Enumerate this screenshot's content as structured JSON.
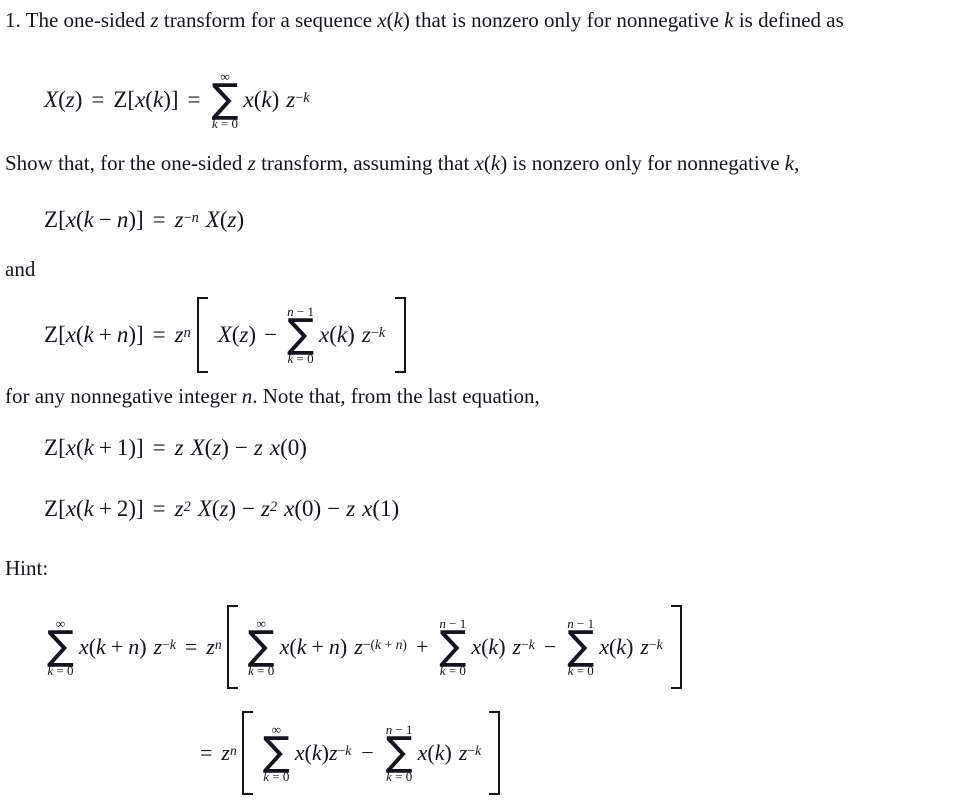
{
  "document": {
    "title": "One-sided z transform problem",
    "background_color": "#ffffff",
    "text_color": "#14141f"
  },
  "prose": {
    "problem_statement": "1. The one-sided z transform for a sequence x(k) that is nonzero only for nonnegative k is defined as",
    "p1_a": "1. The one-sided ",
    "p1_z": "z",
    "p1_b": " transform for a sequence ",
    "p1_x": "x",
    "p1_c": "(",
    "p1_k": "k",
    "p1_d": ") that is nonzero only for nonnegative ",
    "p1_k2": "k",
    "p1_e": " is defined as",
    "show_that_full": "Show that, for the one-sided z transform, assuming that x(k) is nonzero only for nonnegative k,",
    "p2_a": "Show that, for the one-sided ",
    "p2_z": "z",
    "p2_b": " transform, assuming that ",
    "p2_x": "x",
    "p2_c": "(",
    "p2_k": "k",
    "p2_d": ") is nonzero only for nonnegative ",
    "p2_k2": "k",
    "p2_e": ",",
    "and": "and",
    "for_any_full": "for any nonnegative integer n. Note that, from the last equation,",
    "p3_a": "for any nonnegative integer ",
    "p3_n": "n",
    "p3_b": ". Note that, from the last equation,",
    "hint_label": "Hint:"
  },
  "symbols": {
    "sigma": "∑",
    "infinity": "∞",
    "minus": "−",
    "plus": "+",
    "equals": "=",
    "lbracket": "[",
    "rbracket": "]",
    "lparen": "(",
    "rparen": ")"
  },
  "equations": {
    "eq1": {
      "name": "definition-of-one-sided-z-transform",
      "latex": "X(z) = Z[x(k)] = \\sum_{k=0}^{\\infty} x(k) z^{-k}",
      "lhs_X": "X",
      "lhs_paren_open": "(",
      "lhs_z": "z",
      "lhs_paren_close": ")",
      "eq_sign": "=",
      "Z": "Z",
      "br_open": "[",
      "x": "x",
      "p_open": "(",
      "k": "k",
      "p_close": ")",
      "br_close": "]",
      "sum_upper": "∞",
      "sum_lower_k": "k",
      "sum_lower_eq": " = 0",
      "term_x": "x",
      "term_k": "k",
      "term_z": "z",
      "term_exp_minus": "−",
      "term_exp_k": "k"
    },
    "eq2": {
      "name": "z-transform-of-delayed-sequence",
      "latex": "Z[x(k-n)] = z^{-n} X(z)",
      "Z": "Z",
      "br_open": "[",
      "x": "x",
      "p_open": "(",
      "k": "k",
      "minus": "−",
      "n": "n",
      "p_close": ")",
      "br_close": "]",
      "eq_sign": "=",
      "z": "z",
      "exp_minus": "−",
      "exp_n": "n",
      "X": "X",
      "Xp_open": "(",
      "Xz": "z",
      "Xp_close": ")"
    },
    "eq3": {
      "name": "z-transform-of-advanced-sequence",
      "latex": "Z[x(k+n)] = z^{n}\\left[X(z) - \\sum_{k=0}^{n-1} x(k) z^{-k}\\right]",
      "Z": "Z",
      "br_open": "[",
      "x": "x",
      "p_open": "(",
      "k": "k",
      "plus": "+",
      "n": "n",
      "p_close": ")",
      "br_close": "]",
      "eq_sign": "=",
      "z": "z",
      "exp_n": "n",
      "X": "X",
      "Xp_open": "(",
      "Xz": "z",
      "Xp_close": ")",
      "minus": "−",
      "sum_upper_n": "n",
      "sum_upper_minus": " − 1",
      "sum_lower_k": "k",
      "sum_lower_eq": " = 0",
      "term_x": "x",
      "term_k": "k",
      "term_z": "z",
      "term_exp_minus": "−",
      "term_exp_k": "k"
    },
    "eq4": {
      "name": "z-transform-shift-by-one",
      "latex": "Z[x(k+1)] = z X(z) - z x(0)",
      "Z": "Z",
      "br_open": "[",
      "x": "x",
      "p_open": "(",
      "k": "k",
      "plus": "+",
      "one": "1",
      "p_close": ")",
      "br_close": "]",
      "eq_sign": "=",
      "z1": "z",
      "X": "X",
      "Xp_open": "(",
      "Xz": "z",
      "Xp_close": ")",
      "minus": "−",
      "z2": "z",
      "x2": "x",
      "x2p_open": "(",
      "zero": "0",
      "x2p_close": ")"
    },
    "eq5": {
      "name": "z-transform-shift-by-two",
      "latex": "Z[x(k+2)] = z^{2} X(z) - z^{2} x(0) - z x(1)",
      "Z": "Z",
      "br_open": "[",
      "x": "x",
      "p_open": "(",
      "k": "k",
      "plus": "+",
      "two": "2",
      "p_close": ")",
      "br_close": "]",
      "eq_sign": "=",
      "z1": "z",
      "z1_exp": "2",
      "X": "X",
      "Xp_open": "(",
      "Xz": "z",
      "Xp_close": ")",
      "minus1": "−",
      "z2": "z",
      "z2_exp": "2",
      "x2": "x",
      "x2p_open": "(",
      "zero": "0",
      "x2p_close": ")",
      "minus2": "−",
      "z3": "z",
      "x3": "x",
      "x3p_open": "(",
      "one": "1",
      "x3p_close": ")"
    },
    "eq6": {
      "name": "hint-line-one",
      "latex": "\\sum_{k=0}^{\\infty} x(k+n) z^{-k} = z^{n}\\left[\\sum_{k=0}^{\\infty} x(k+n) z^{-(k+n)} + \\sum_{k=0}^{n-1} x(k) z^{-k} - \\sum_{k=0}^{n-1} x(k) z^{-k}\\right]",
      "s1_upper": "∞",
      "s1_lower_k": "k",
      "s1_lower_eq": " = 0",
      "s1_x": "x",
      "s1_p_open": "(",
      "s1_k": "k",
      "s1_plus": "+",
      "s1_n": "n",
      "s1_p_close": ")",
      "s1_z": "z",
      "s1_exp_minus": "−",
      "s1_exp_k": "k",
      "eq_sign": "=",
      "z": "z",
      "z_exp_n": "n",
      "s2_upper": "∞",
      "s2_lower_k": "k",
      "s2_lower_eq": " = 0",
      "s2_x": "x",
      "s2_p_open": "(",
      "s2_k": "k",
      "s2_plus": "+",
      "s2_n": "n",
      "s2_p_close": ")",
      "s2_z": "z",
      "s2_exp": "−(",
      "s2_exp_k": "k",
      "s2_exp_plus": " + ",
      "s2_exp_n": "n",
      "s2_exp_close": ")",
      "plus": "+",
      "s3_upper_n": "n",
      "s3_upper_minus": " − 1",
      "s3_lower_k": "k",
      "s3_lower_eq": " = 0",
      "s3_x": "x",
      "s3_p_open": "(",
      "s3_k": "k",
      "s3_p_close": ")",
      "s3_z": "z",
      "s3_exp_minus": "−",
      "s3_exp_k": "k",
      "minus": "−",
      "s4_upper_n": "n",
      "s4_upper_minus": " − 1",
      "s4_lower_k": "k",
      "s4_lower_eq": " = 0",
      "s4_x": "x",
      "s4_p_open": "(",
      "s4_k": "k",
      "s4_p_close": ")",
      "s4_z": "z",
      "s4_exp_minus": "−",
      "s4_exp_k": "k"
    },
    "eq7": {
      "name": "hint-line-two",
      "latex": "= z^{n}\\left[\\sum_{k=0}^{\\infty} x(k)z^{-k} - \\sum_{k=0}^{n-1} x(k) z^{-k}\\right]",
      "eq_sign": "=",
      "z": "z",
      "z_exp_n": "n",
      "s1_upper": "∞",
      "s1_lower_k": "k",
      "s1_lower_eq": " = 0",
      "s1_x": "x",
      "s1_p_open": "(",
      "s1_k": "k",
      "s1_p_close": ")",
      "s1_z": "z",
      "s1_exp_minus": "−",
      "s1_exp_k": "k",
      "minus": "−",
      "s2_upper_n": "n",
      "s2_upper_minus": " − 1",
      "s2_lower_k": "k",
      "s2_lower_eq": " = 0",
      "s2_x": "x",
      "s2_p_open": "(",
      "s2_k": "k",
      "s2_p_close": ")",
      "s2_z": "z",
      "s2_exp_minus": "−",
      "s2_exp_k": "k"
    }
  }
}
